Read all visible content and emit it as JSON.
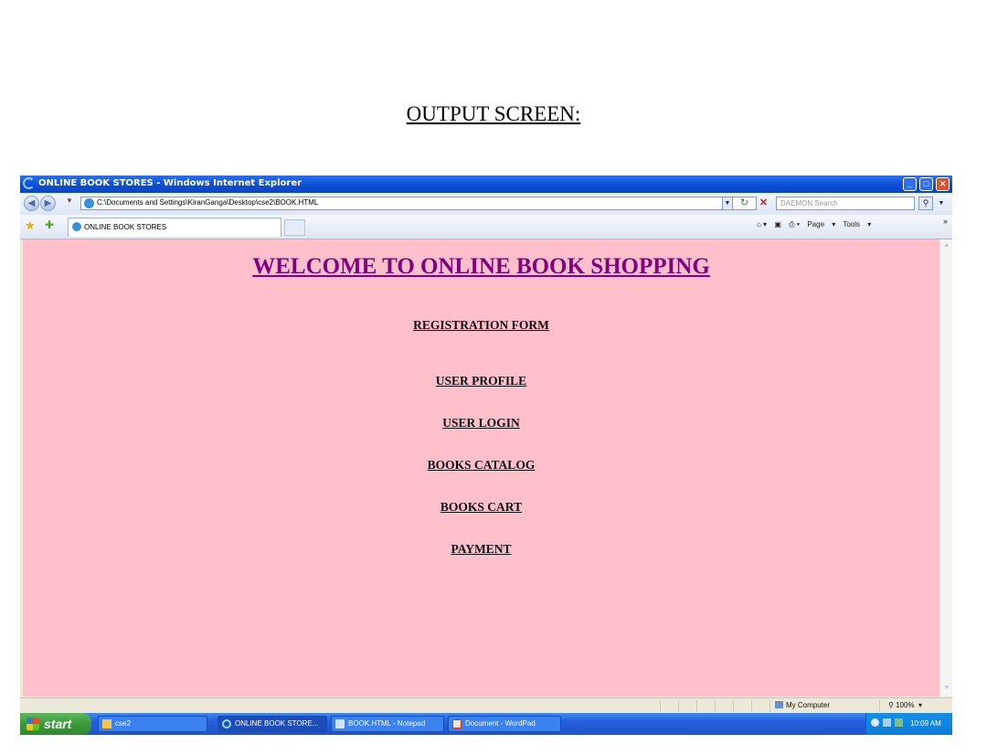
{
  "document": {
    "heading": "OUTPUT SCREEN:"
  },
  "window": {
    "title": "ONLINE BOOK STORES - Windows Internet Explorer"
  },
  "address_bar": {
    "url": "C:\\Documents and Settings\\KiranGanga\\Desktop\\cse2\\BOOK.HTML",
    "search_placeholder": "DAEMON Search"
  },
  "tab": {
    "label": "ONLINE BOOK STORES"
  },
  "toolbar": {
    "page_label": "Page",
    "tools_label": "Tools"
  },
  "page": {
    "heading": "WELCOME TO ONLINE BOOK SHOPPING",
    "links": [
      "REGISTRATION FORM",
      "USER PROFILE",
      "USER LOGIN",
      "BOOKS CATALOG",
      "BOOKS CART",
      "PAYMENT"
    ]
  },
  "status_bar": {
    "zone": "My Computer",
    "zoom": "100%"
  },
  "taskbar": {
    "start_label": "start",
    "tasks": [
      "cse2",
      "ONLINE BOOK STORE...",
      "BOOK.HTML - Notepad",
      "Document - WordPad"
    ],
    "clock": "10:09 AM"
  },
  "colors": {
    "page_background": "#ffc0cb",
    "heading_color": "#800080",
    "taskbar_blue": "#245edb"
  }
}
